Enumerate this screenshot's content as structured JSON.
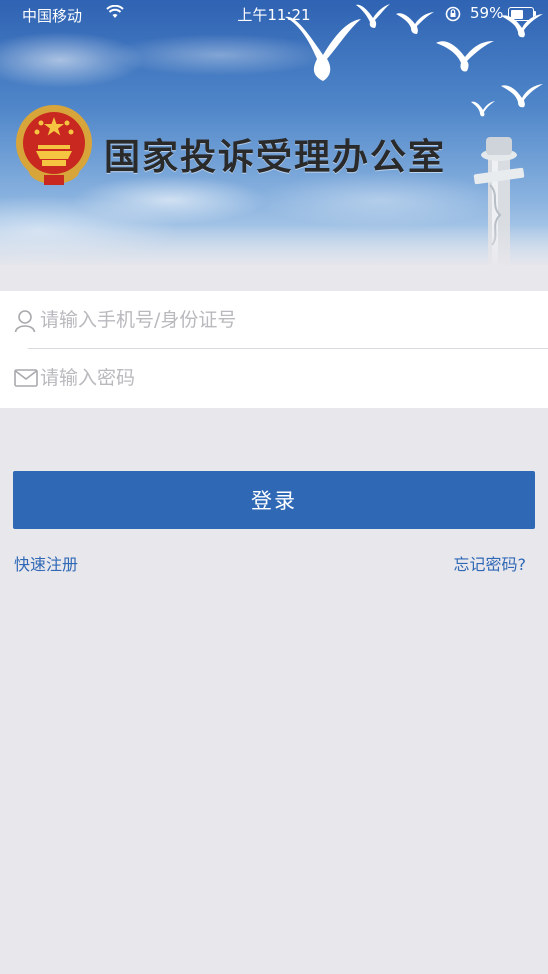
{
  "status_bar": {
    "carrier": "中国移动",
    "time": "上午11:21",
    "battery_percent": "59%",
    "battery_level": 0.59
  },
  "banner": {
    "title": "国家投诉受理办公室",
    "emblem_icon": "national-emblem-icon"
  },
  "form": {
    "phone_placeholder": "请输入手机号/身份证号",
    "phone_value": "",
    "password_placeholder": "请输入密码",
    "password_value": "",
    "phone_icon": "user-icon",
    "password_icon": "envelope-icon"
  },
  "actions": {
    "login_label": "登录",
    "register_label": "快速注册",
    "forgot_label": "忘记密码?"
  },
  "colors": {
    "accent": "#2f69b6",
    "background": "#e8e7ec"
  }
}
